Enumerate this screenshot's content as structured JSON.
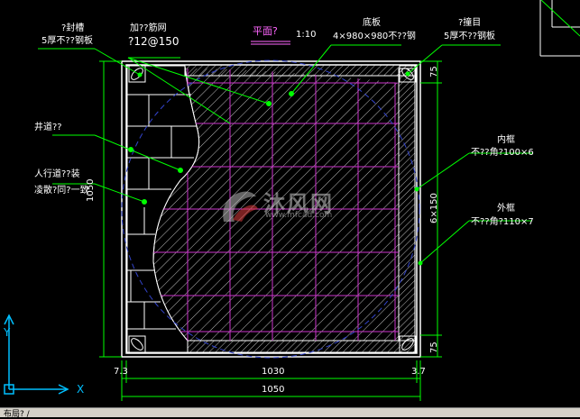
{
  "drawing": {
    "title_plan": "平面?",
    "scale": "1:10",
    "labels": {
      "top_left_name": "?封槽",
      "top_left_spec": "5厚不??钢板",
      "top_rebar_name": "加??筋网",
      "top_rebar_spec": "?12@150",
      "bottom_plate_name": "底板",
      "bottom_plate_spec": "4×980×980不??钢",
      "top_right_name": "?撞目",
      "top_right_spec": "5厚不??钢板",
      "well_name": "井道??",
      "sidewalk_line1": "人行道??装",
      "sidewalk_line2": "凌散?同?一致",
      "inner_frame_name": "内框",
      "inner_frame_spec": "不??角?100×6",
      "outer_frame_name": "外框",
      "outer_frame_spec": "不??角?110×7"
    },
    "dimensions": {
      "left_height": "1050",
      "right_span": "6×150",
      "right_top": "75",
      "right_bottom": "75",
      "bottom_inner": "1030",
      "bottom_outer": "1050",
      "bottom_left_small": "7.3",
      "bottom_right_small": "3.7"
    },
    "watermark": {
      "text": "沐风网",
      "url": "www.mfcad.com"
    },
    "ucs": {
      "x_label": "X",
      "y_label": "Y"
    }
  },
  "status_bar": {
    "text": "布局? /"
  },
  "colors": {
    "background": "#000000",
    "frame": "#ffffff",
    "grid": "#cc33cc",
    "leader": "#00ff00",
    "dimension": "#00ff00",
    "dashed_circle": "#3344cc",
    "ucs": "#00bfff"
  }
}
